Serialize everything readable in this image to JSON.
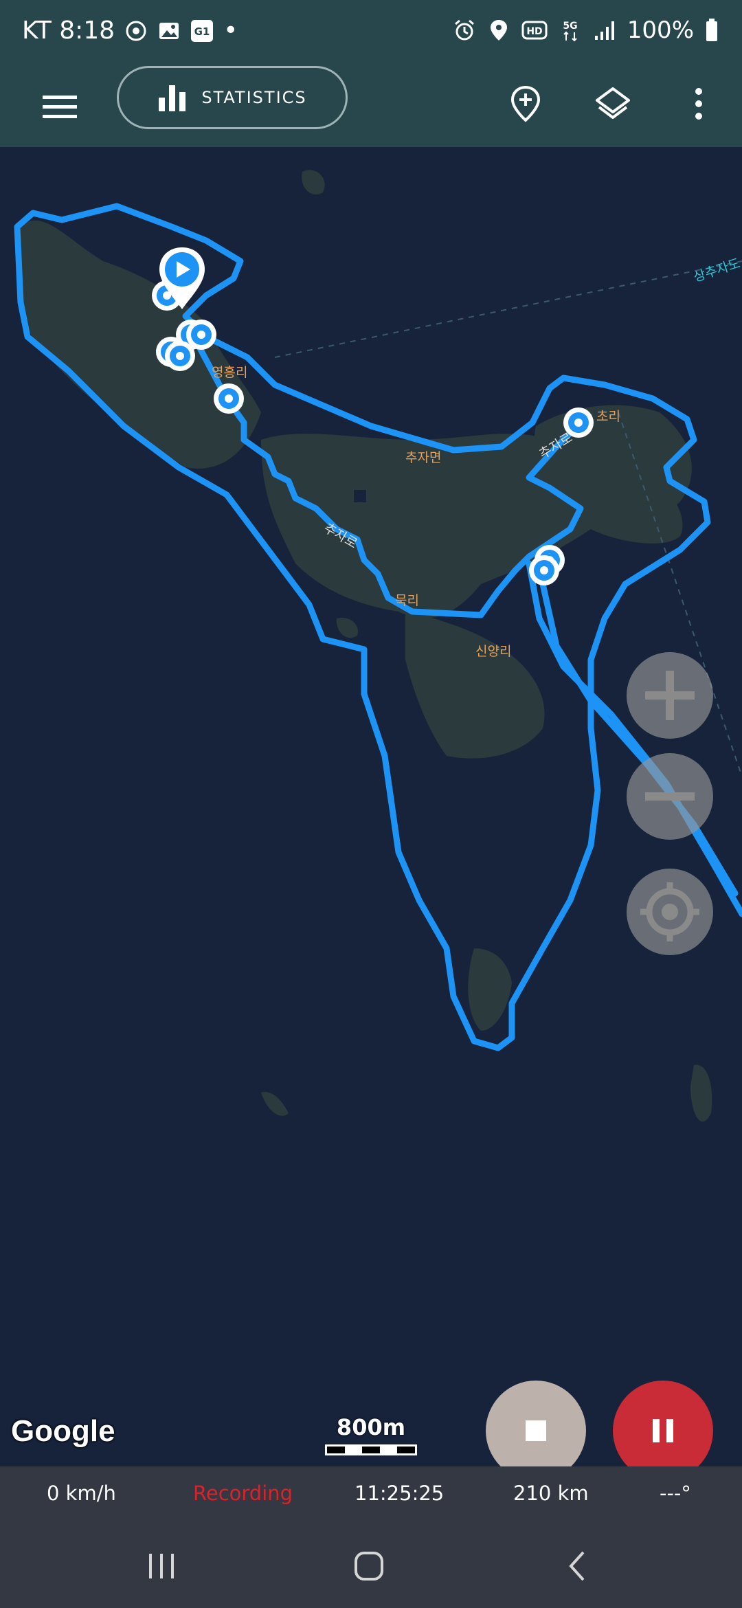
{
  "status_bar": {
    "carrier_time": "KT 8:18",
    "badge_text": "G1",
    "dot": "•",
    "battery": "100%",
    "icons_left": [
      "location-target-icon",
      "gallery-icon",
      "g1-app-icon"
    ],
    "icons_right": [
      "alarm-icon",
      "location-pin-icon",
      "hd-icon",
      "5g-icon",
      "signal-icon",
      "battery-icon"
    ],
    "hd_label": "HD",
    "net_label": "5G"
  },
  "toolbar": {
    "statistics_label": "STATISTICS",
    "icons": [
      "menu-icon",
      "bar-chart-icon",
      "add-marker-icon",
      "layers-icon",
      "more-vert-icon"
    ]
  },
  "map": {
    "labels": [
      "영흥리",
      "추자면",
      "추자로",
      "묵리",
      "신양리",
      "초리",
      "추자로"
    ],
    "offmap_label": "상추자도",
    "track_color": "#1c93f5",
    "water_color": "#16233b",
    "land_color": "#2b3a3c",
    "road_label_color": "#e6a15a"
  },
  "controls": {
    "zoom_in_icon": "plus-icon",
    "zoom_out_icon": "minus-icon",
    "locate_icon": "my-location-icon",
    "google_logo": "Google",
    "scale_label": "800m",
    "stop_icon": "stop-icon",
    "pause_icon": "pause-icon"
  },
  "info_bar": {
    "speed": "0 km/h",
    "status": "Recording",
    "duration": "11:25:25",
    "distance": "210 km",
    "bearing": "---°",
    "status_color": "#d8232a"
  },
  "nav_bar": {
    "icons": [
      "recent-apps-icon",
      "home-icon",
      "back-icon"
    ]
  }
}
